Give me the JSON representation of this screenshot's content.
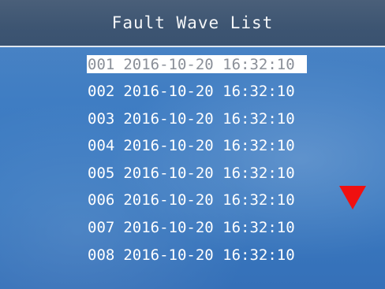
{
  "title": "Fault Wave List",
  "records": [
    {
      "index": "001",
      "timestamp": "2016-10-20 16:32:10",
      "selected": true
    },
    {
      "index": "002",
      "timestamp": "2016-10-20 16:32:10",
      "selected": false
    },
    {
      "index": "003",
      "timestamp": "2016-10-20 16:32:10",
      "selected": false
    },
    {
      "index": "004",
      "timestamp": "2016-10-20 16:32:10",
      "selected": false
    },
    {
      "index": "005",
      "timestamp": "2016-10-20 16:32:10",
      "selected": false
    },
    {
      "index": "006",
      "timestamp": "2016-10-20 16:32:10",
      "selected": false
    },
    {
      "index": "007",
      "timestamp": "2016-10-20 16:32:10",
      "selected": false
    },
    {
      "index": "008",
      "timestamp": "2016-10-20 16:32:10",
      "selected": false
    }
  ],
  "scroll_indicator": {
    "icon": "triangle-down-icon",
    "color": "#f01010"
  },
  "colors": {
    "title_bar": "#3d5572",
    "background": "#3f7dc3",
    "selection": "#ffffff",
    "text": "#ffffff"
  }
}
